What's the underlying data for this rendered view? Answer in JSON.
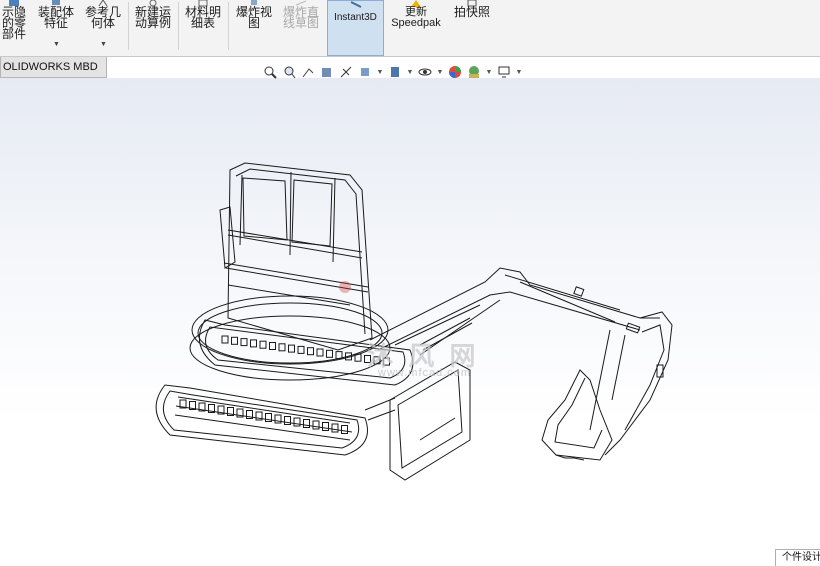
{
  "ribbon": {
    "items": [
      {
        "label": "示隐\n的零\n部件"
      },
      {
        "label": "装配体\n特征"
      },
      {
        "label": "参考几\n何体"
      },
      {
        "label": "新建运\n动算例"
      },
      {
        "label": "材料明\n细表"
      },
      {
        "label": "爆炸视\n图"
      },
      {
        "label": "爆炸直\n线草图"
      },
      {
        "label": "Instant3D"
      },
      {
        "label": "更新\nSpeedpak"
      },
      {
        "label": "拍快照"
      }
    ]
  },
  "tabs": {
    "mbd": "OLIDWORKS MBD"
  },
  "watermark": {
    "cn": "沐 风 网",
    "url": "www.mfcad.com"
  },
  "status_tab": "个件设计"
}
